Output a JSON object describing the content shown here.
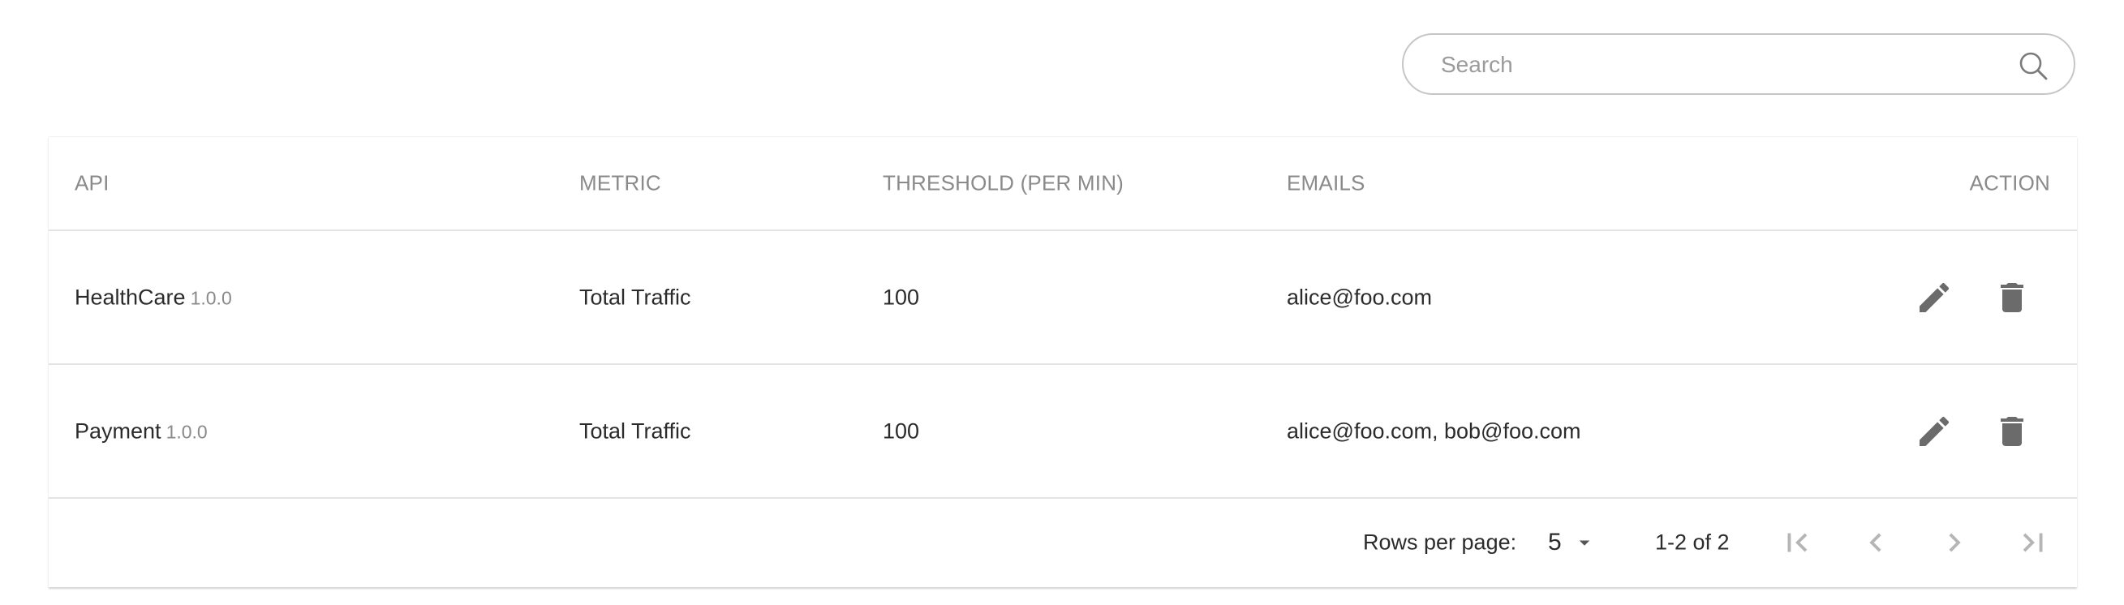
{
  "search": {
    "placeholder": "Search"
  },
  "table": {
    "headers": {
      "api": "API",
      "metric": "METRIC",
      "threshold": "THRESHOLD (PER MIN)",
      "emails": "EMAILS",
      "action": "ACTION"
    },
    "rows": [
      {
        "api_name": "HealthCare",
        "api_version": "1.0.0",
        "metric": "Total Traffic",
        "threshold": "100",
        "emails": "alice@foo.com"
      },
      {
        "api_name": "Payment",
        "api_version": "1.0.0",
        "metric": "Total Traffic",
        "threshold": "100",
        "emails": "alice@foo.com, bob@foo.com"
      }
    ]
  },
  "pagination": {
    "rows_per_page_label": "Rows per page:",
    "rows_per_page_value": "5",
    "range_text": "1-2 of 2"
  },
  "icons": {
    "search": "search-icon",
    "edit": "pencil-icon",
    "delete": "trash-icon",
    "dropdown": "caret-down-icon",
    "first_page": "first-page-icon",
    "previous_page": "chevron-left-icon",
    "next_page": "chevron-right-icon",
    "last_page": "last-page-icon"
  },
  "colors": {
    "header_text": "#8a8a8a",
    "icon": "#6b6b6b",
    "pager_disabled": "#b5b5b5",
    "border": "#e4e4e4"
  }
}
